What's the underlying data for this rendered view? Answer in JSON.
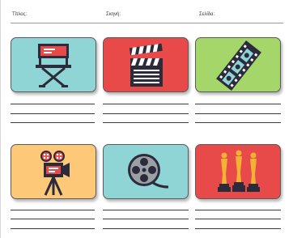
{
  "header": {
    "title_label": "Τίτλος:",
    "scene_label": "Σκηνή:",
    "page_label": "Σελίδα:"
  },
  "colors": {
    "turquoise": "#8fd5d6",
    "red": "#e84a49",
    "green": "#a4d66a",
    "orange": "#fdc877"
  },
  "frames": [
    {
      "background": "turquoise",
      "icon": "director-chair-icon"
    },
    {
      "background": "red",
      "icon": "clapperboard-icon"
    },
    {
      "background": "green",
      "icon": "film-strip-icon"
    },
    {
      "background": "orange",
      "icon": "film-projector-icon"
    },
    {
      "background": "turquoise",
      "icon": "film-reel-icon"
    },
    {
      "background": "red",
      "icon": "award-statuettes-icon"
    }
  ]
}
